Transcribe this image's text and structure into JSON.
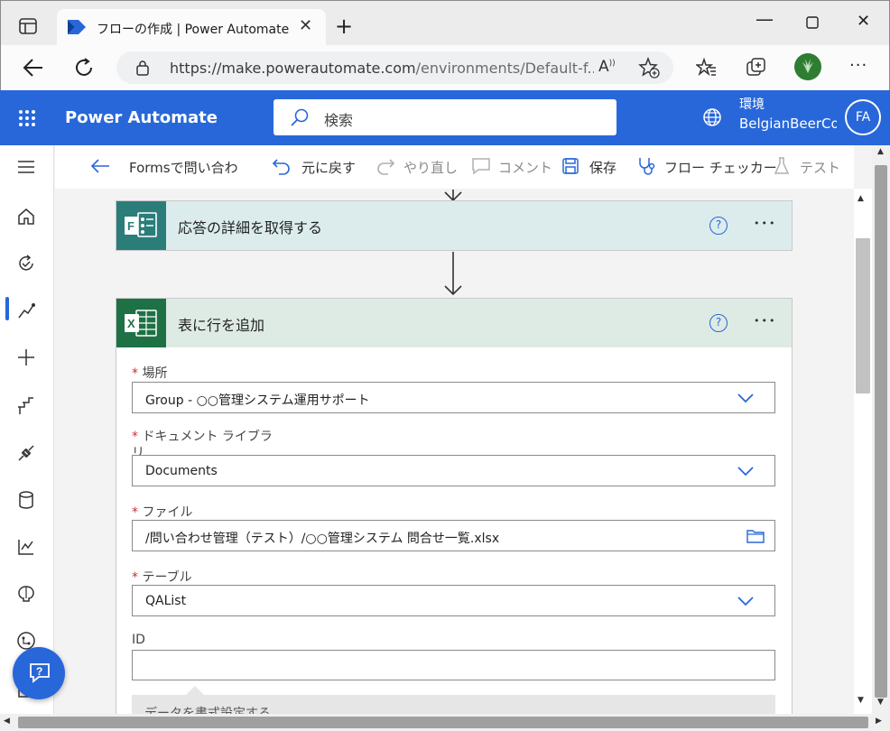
{
  "browser": {
    "tab_title": "フローの作成 | Power Automate",
    "url_host": "https://make.powerautomate.com",
    "url_path": "/environments/Default-f..."
  },
  "header": {
    "app_name": "Power Automate",
    "search_placeholder": "検索",
    "env_label": "環境",
    "env_name": "BelgianBeerCo",
    "avatar": "FA"
  },
  "toolbar": {
    "flow_name": "Formsで問い合わ",
    "undo": "元に戻す",
    "redo": "やり直し",
    "comment": "コメント",
    "save": "保存",
    "checker": "フロー チェッカー",
    "test": "テスト"
  },
  "forms_card": {
    "title": "応答の詳細を取得する",
    "help": "?",
    "more": "•••"
  },
  "excel_card": {
    "title": "表に行を追加",
    "help": "?",
    "more": "•••",
    "fields": {
      "location_label": "場所",
      "location_value": "Group - ○○管理システム運用サポート",
      "library_label": "ドキュメント ライブラリ",
      "library_value": "Documents",
      "file_label": "ファイル",
      "file_value": "/問い合わせ管理（テスト）/○○管理システム 問合せ一覧.xlsx",
      "table_label": "テーブル",
      "table_value": "QAList",
      "id_label": "ID",
      "id_value": "",
      "format_hint": "データを書式設定する"
    }
  },
  "colors": {
    "brand_blue": "#2867d9",
    "forms_teal": "#2b7d7a",
    "excel_green": "#1e7145"
  }
}
